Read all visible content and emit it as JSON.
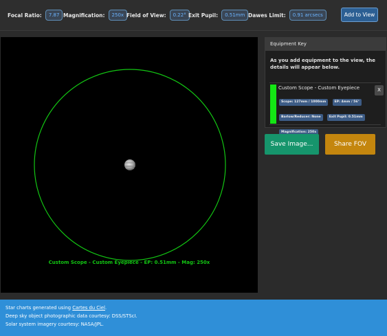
{
  "stats": [
    {
      "label": "Focal Ratio:",
      "value": "7.87"
    },
    {
      "label": "Magnification:",
      "value": "250x"
    },
    {
      "label": "Field of View:",
      "value": "0.22°"
    },
    {
      "label": "Exit Pupil:",
      "value": "0.51mm"
    },
    {
      "label": "Dawes Limit:",
      "value": "0.91 arcsecs"
    }
  ],
  "add_button_label": "Add to View",
  "view": {
    "fov_label": "Custom Scope - Custom Eyepiece - EP: 0.51mm - Mag: 250x",
    "fov_color": "#13c613",
    "background_color": "#000000"
  },
  "equipment_key": {
    "title": "Equipment Key",
    "description": "As you add equipment to the view, the details will appear below.",
    "items": [
      {
        "name": "Custom Scope - Custom Eyepiece",
        "color": "#14e614",
        "tags": [
          "Scope: 127mm / 1000mm",
          "EP: 4mm / 56°",
          "Barlow/Reducer: None",
          "Exit Pupil: 0.51mm",
          "Magnification: 250x"
        ],
        "remove_label": "X"
      }
    ]
  },
  "buttons": {
    "save_image": "Save Image...",
    "share_fov": "Share FOV"
  },
  "credits": {
    "line1_prefix": "Star charts generated using ",
    "line1_link": "Cartes du Ciel",
    "line1_suffix": ".",
    "line2": "Deep sky object photographic data courtesy: DSS/STScI.",
    "line3": "Solar system imagery courtesy: NASA/JPL."
  },
  "colors": {
    "accent_blue": "#2f8fd8",
    "save_green": "#16956c",
    "share_orange": "#c4860e"
  }
}
